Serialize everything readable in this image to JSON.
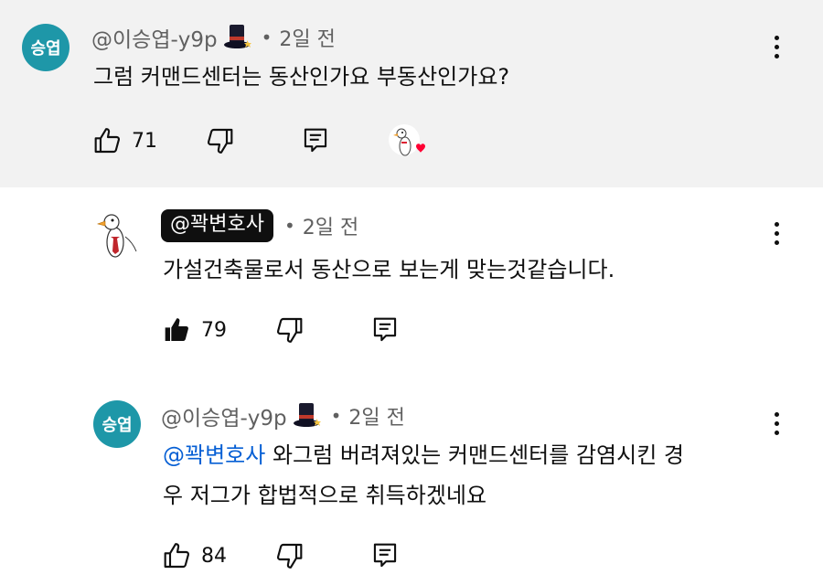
{
  "comments": [
    {
      "avatar_text": "승엽",
      "handle": "@이승엽-y9p",
      "time": "2일 전",
      "text": "그럼 커맨드센터는 동산인가요 부동산인가요?",
      "likes": "71"
    },
    {
      "handle": "@꽉변호사",
      "time": "2일 전",
      "text": "가설건축물로서 동산으로 보는게 맞는것같습니다.",
      "likes": "79"
    },
    {
      "avatar_text": "승엽",
      "handle": "@이승엽-y9p",
      "time": "2일 전",
      "mention": "@꽉변호사",
      "text_line1": " 와그럼 버려져있는 커맨드센터를 감염시킨 경",
      "text_line2": "우 저그가 합법적으로 취득하겠네요",
      "likes": "84"
    }
  ],
  "separator": "•",
  "icons": {
    "like": "thumbs-up-icon",
    "like_filled": "thumbs-up-filled-icon",
    "dislike": "thumbs-down-icon",
    "reply": "reply-icon",
    "more": "more-vert-icon",
    "badge": "top-hat-icon",
    "creator_heart": "creator-heart-icon"
  },
  "colors": {
    "highlight_bg": "#f2f2f2",
    "avatar_teal": "#1e97a8",
    "mention_blue": "#065fd4",
    "heart_red": "#ff0033"
  }
}
